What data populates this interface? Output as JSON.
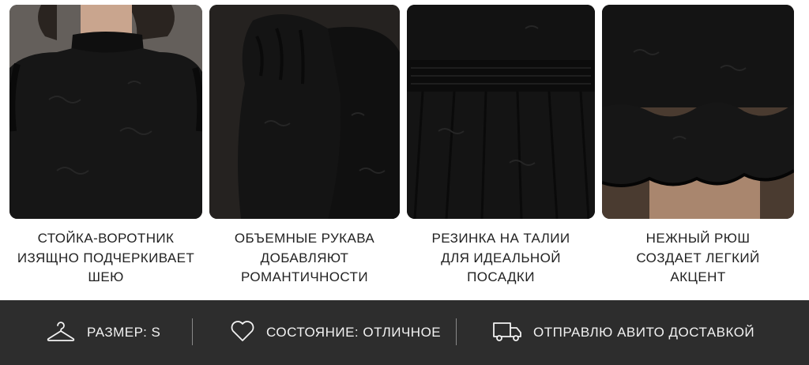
{
  "features": [
    {
      "lines": [
        "СТОЙКА-ВОРОТНИК",
        "ИЗЯЩНО ПОДЧЕРКИВАЕТ",
        "ШЕЮ"
      ]
    },
    {
      "lines": [
        "ОБЪЕМНЫЕ РУКАВА",
        "ДОБАВЛЯЮТ",
        "РОМАНТИЧНОСТИ"
      ]
    },
    {
      "lines": [
        "РЕЗИНКА НА ТАЛИИ",
        "ДЛЯ ИДЕАЛЬНОЙ",
        "ПОСАДКИ"
      ]
    },
    {
      "lines": [
        "НЕЖНЫЙ РЮШ",
        "СОЗДАЕТ ЛЕГКИЙ",
        "АКЦЕНТ"
      ]
    }
  ],
  "info_bar": {
    "size_label": "РАЗМЕР: S",
    "size_icon": "hanger-icon",
    "condition_label": "СОСТОЯНИЕ: ОТЛИЧНОЕ",
    "condition_icon": "heart-icon",
    "delivery_label": "ОТПРАВЛЮ АВИТО ДОСТАВКОЙ",
    "delivery_icon": "truck-icon"
  },
  "colors": {
    "fabric": "#141414",
    "bar_background": "#2d2d2d",
    "bar_text": "#f2f2f2",
    "caption_text": "#222222"
  }
}
